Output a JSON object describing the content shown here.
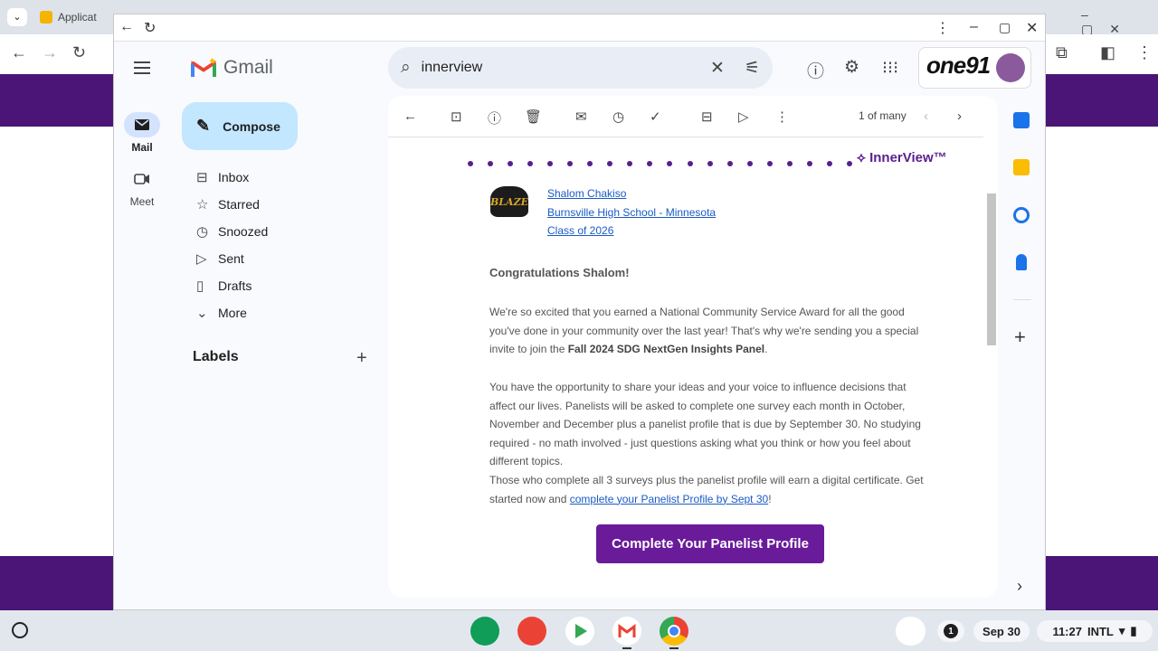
{
  "background": {
    "tabs": [
      "Applicat",
      "",
      "",
      "",
      "",
      "",
      "",
      "",
      "",
      ""
    ],
    "accent": "#4a1576"
  },
  "gmail": {
    "app_name": "Gmail",
    "rail": [
      {
        "label": "Mail",
        "icon": "mail-icon"
      },
      {
        "label": "Meet",
        "icon": "video-icon"
      }
    ],
    "compose_label": "Compose",
    "nav": [
      {
        "label": "Inbox",
        "icon": "inbox-icon"
      },
      {
        "label": "Starred",
        "icon": "star-icon"
      },
      {
        "label": "Snoozed",
        "icon": "clock-icon"
      },
      {
        "label": "Sent",
        "icon": "send-icon"
      },
      {
        "label": "Drafts",
        "icon": "draft-icon"
      },
      {
        "label": "More",
        "icon": "chevron-down-icon"
      }
    ],
    "labels_heading": "Labels",
    "search_value": "innerview",
    "account_logo_text": "one91"
  },
  "toolbar": {
    "pager": "1 of many"
  },
  "email": {
    "brand": "InnerView™",
    "crest_text": "BLAZE",
    "student_name": "Shalom Chakiso",
    "school": "Burnsville High School - Minnesota",
    "class_year": "Class of 2026",
    "greeting": "Congratulations Shalom!",
    "p1_a": "We're so excited that you earned a National Community Service Award for all the good you've done in your community over the last year! That's why we're sending you a special invite to join the ",
    "p1_bold": "Fall 2024 SDG NextGen Insights Panel",
    "p1_b": ".",
    "p2": "You have the opportunity to share your ideas and your voice to influence decisions that affect our lives. Panelists will be asked to complete one survey each month in October, November and December plus a panelist profile that is due by September 30. No studying required - no math involved - just questions asking what you think or how you feel about different topics.",
    "p3_a": "Those who complete all 3 surveys plus the panelist profile will earn a digital certificate. Get started now and ",
    "p3_link": "complete your Panelist Profile by Sept 30",
    "p3_b": "!",
    "cta": "Complete Your Panelist Profile"
  },
  "shelf": {
    "notifications": "1",
    "date": "Sep 30",
    "time": "11:27",
    "ime": "INTL"
  }
}
